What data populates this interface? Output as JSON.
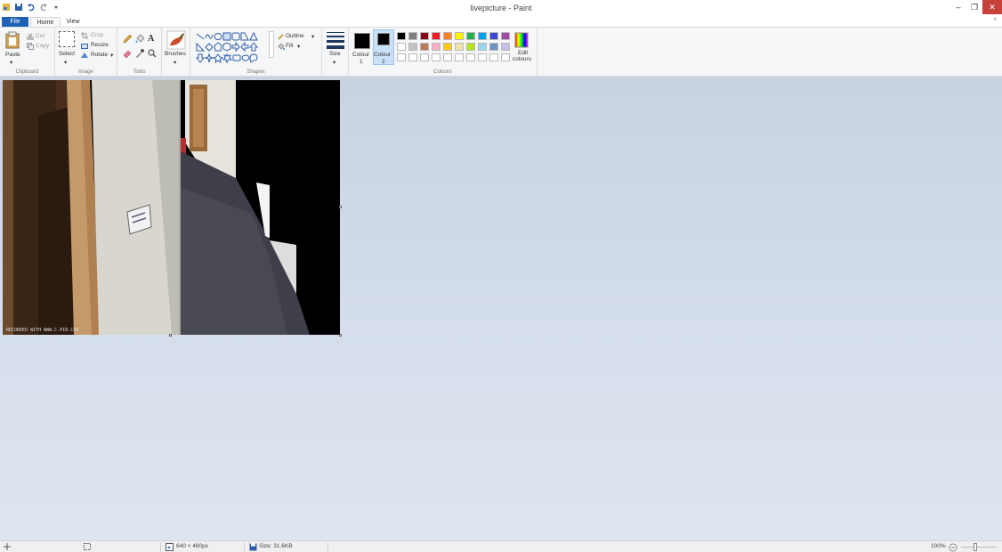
{
  "window": {
    "title": "livepicture - Paint",
    "minimize": "–",
    "restore": "❐",
    "close": "✕"
  },
  "tabs": {
    "file": "File",
    "home": "Home",
    "view": "View",
    "collapse": "^"
  },
  "ribbon": {
    "clipboard": {
      "paste": "Paste",
      "cut": "Cut",
      "copy": "Copy",
      "label": "Clipboard"
    },
    "image": {
      "select": "Select",
      "crop": "Crop",
      "resize": "Resize",
      "rotate": "Rotate",
      "label": "Image"
    },
    "tools": {
      "label": "Tools",
      "text_tool": "A"
    },
    "brushes": {
      "label": "Brushes"
    },
    "shapes": {
      "outline": "Outline",
      "fill": "Fill",
      "label": "Shapes"
    },
    "size": {
      "label": "Size"
    },
    "colours": {
      "colour1": "Colour",
      "colour1_num": "1",
      "colour2": "Colour",
      "colour2_num": "2",
      "edit": "Edit",
      "edit2": "colours",
      "label": "Colours",
      "row1": [
        "#000000",
        "#7f7f7f",
        "#880015",
        "#ed1c24",
        "#ff7f27",
        "#fff200",
        "#22b14c",
        "#00a2e8",
        "#3f48cc",
        "#a349a4"
      ],
      "row2": [
        "#ffffff",
        "#c3c3c3",
        "#b97a57",
        "#ffaec9",
        "#ffc90e",
        "#efe4b0",
        "#b5e61d",
        "#99d9ea",
        "#7092be",
        "#c8bfe7"
      ],
      "row3": [
        "#ffffff",
        "#ffffff",
        "#ffffff",
        "#ffffff",
        "#ffffff",
        "#ffffff",
        "#ffffff",
        "#ffffff",
        "#ffffff",
        "#ffffff"
      ]
    }
  },
  "canvas": {
    "watermark": "RECORDED WITH WWW.C-PIR.COM"
  },
  "status": {
    "dimensions": "640 × 480px",
    "size": "Size: 31.6KB",
    "zoom": "100%"
  }
}
